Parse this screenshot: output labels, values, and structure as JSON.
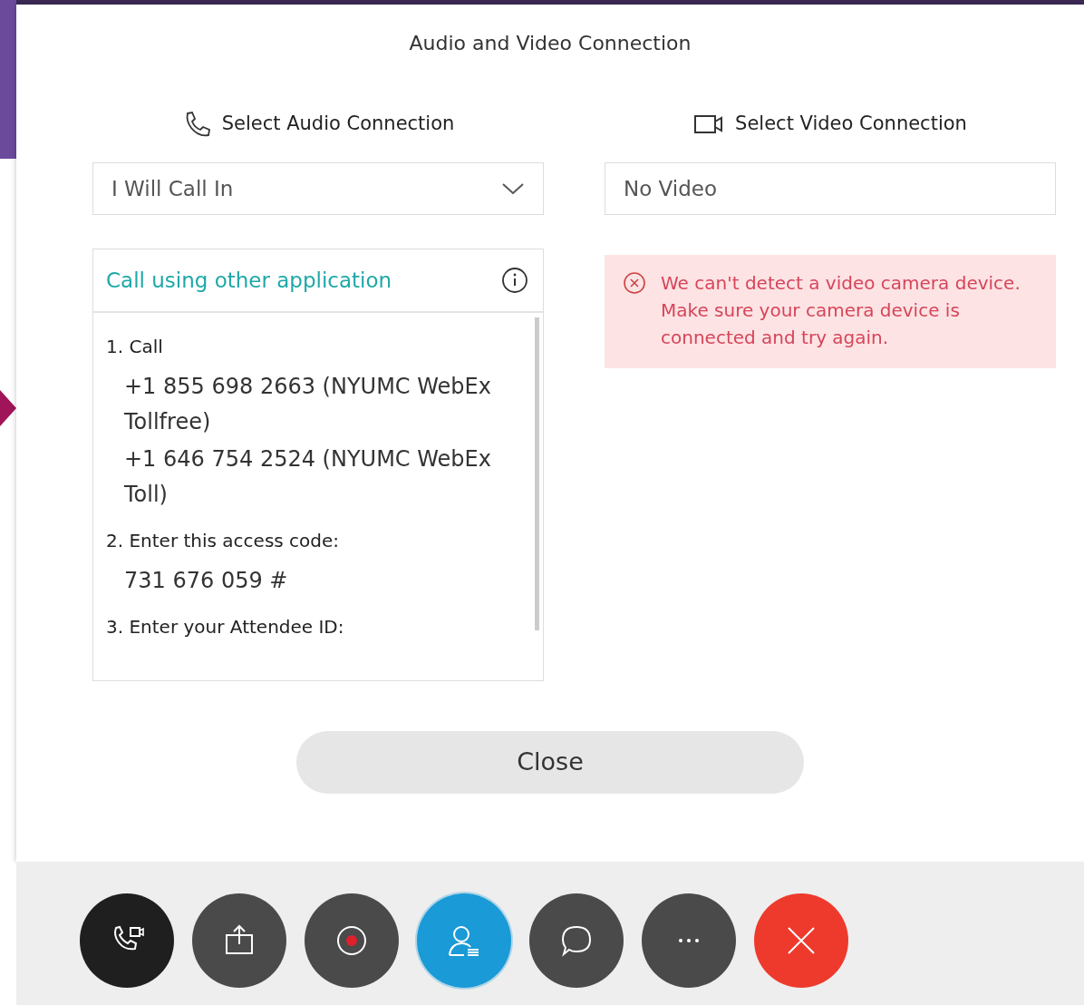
{
  "dialog": {
    "title": "Audio and Video Connection"
  },
  "audio": {
    "heading": "Select Audio Connection",
    "dropdown": "I Will Call In",
    "panel": {
      "title": "Call using other application",
      "steps": [
        {
          "label": "1. Call",
          "lines": [
            "+1 855 698 2663 (NYUMC WebEx Tollfree)",
            "+1 646 754 2524 (NYUMC WebEx Toll)"
          ]
        },
        {
          "label": "2. Enter this access code:",
          "lines": [
            "731 676 059 #"
          ]
        },
        {
          "label": "3. Enter your Attendee ID:"
        }
      ]
    }
  },
  "video": {
    "heading": "Select Video Connection",
    "dropdown": "No Video",
    "error": "We can't detect a video camera device. Make sure your camera device is connected and try again."
  },
  "close_button": "Close",
  "toolbar": [
    {
      "kind": "audio",
      "color": "#1f1f1f",
      "selected": false
    },
    {
      "kind": "share",
      "color": "#4a4a4a",
      "selected": false
    },
    {
      "kind": "record",
      "color": "#4a4a4a",
      "selected": false
    },
    {
      "kind": "participants",
      "color": "#1a9ad6",
      "selected": true
    },
    {
      "kind": "chat",
      "color": "#4a4a4a",
      "selected": false
    },
    {
      "kind": "more",
      "color": "#4a4a4a",
      "selected": false
    },
    {
      "kind": "leave",
      "color": "#ee3a2c",
      "selected": false
    }
  ]
}
